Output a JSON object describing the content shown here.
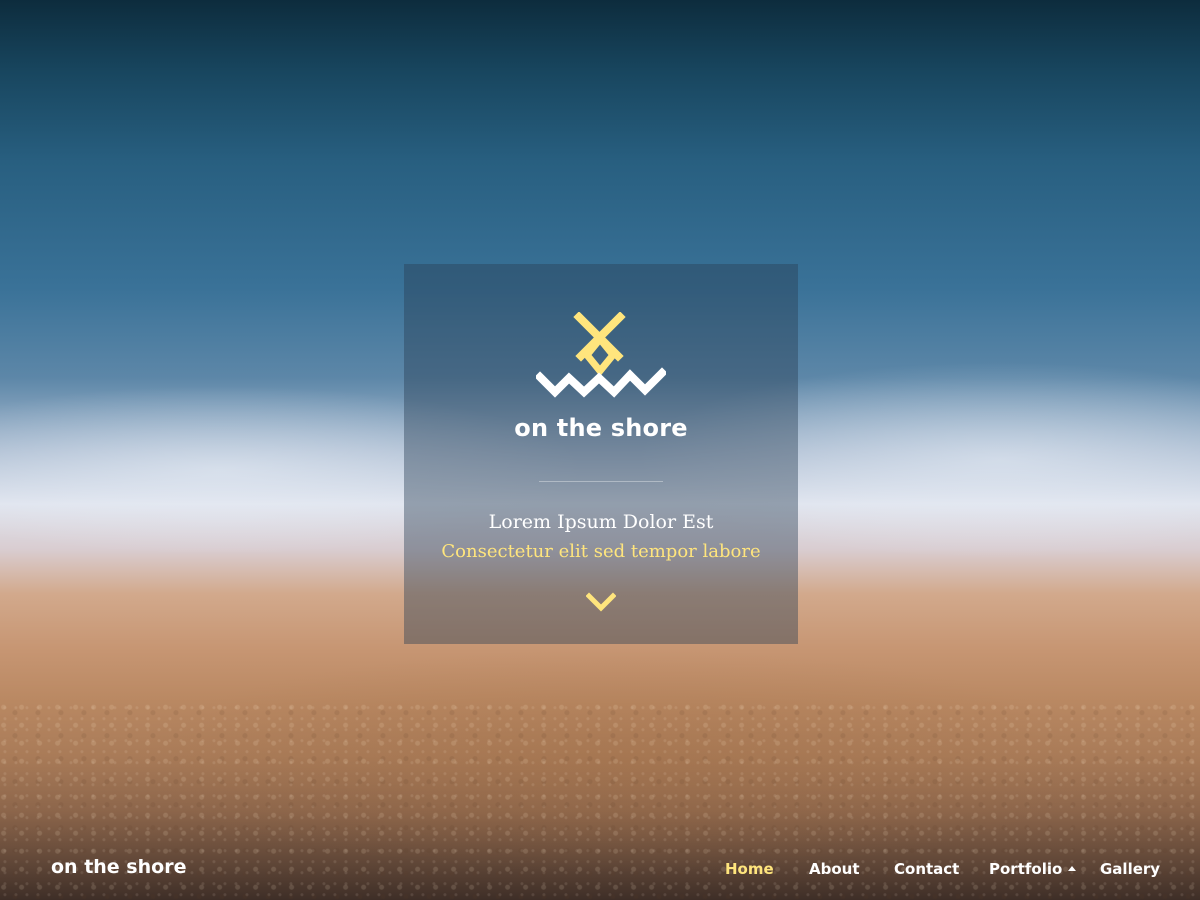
{
  "brand": {
    "name": "on the shore"
  },
  "hero": {
    "tagline": "Lorem Ipsum Dolor Est",
    "subtagline": "Consectetur elit sed tempor labore",
    "scroll_icon": "chevron-down-icon",
    "logo_icon": "wave-diamond-logo-icon"
  },
  "footer": {
    "brand_text": "on the shore",
    "nav": {
      "home": "Home",
      "about": "About",
      "contact": "Contact",
      "portfolio": "Portfolio",
      "gallery": "Gallery"
    },
    "active_item": "Home"
  },
  "colors": {
    "accent": "#ffe57d",
    "text": "#ffffff"
  }
}
